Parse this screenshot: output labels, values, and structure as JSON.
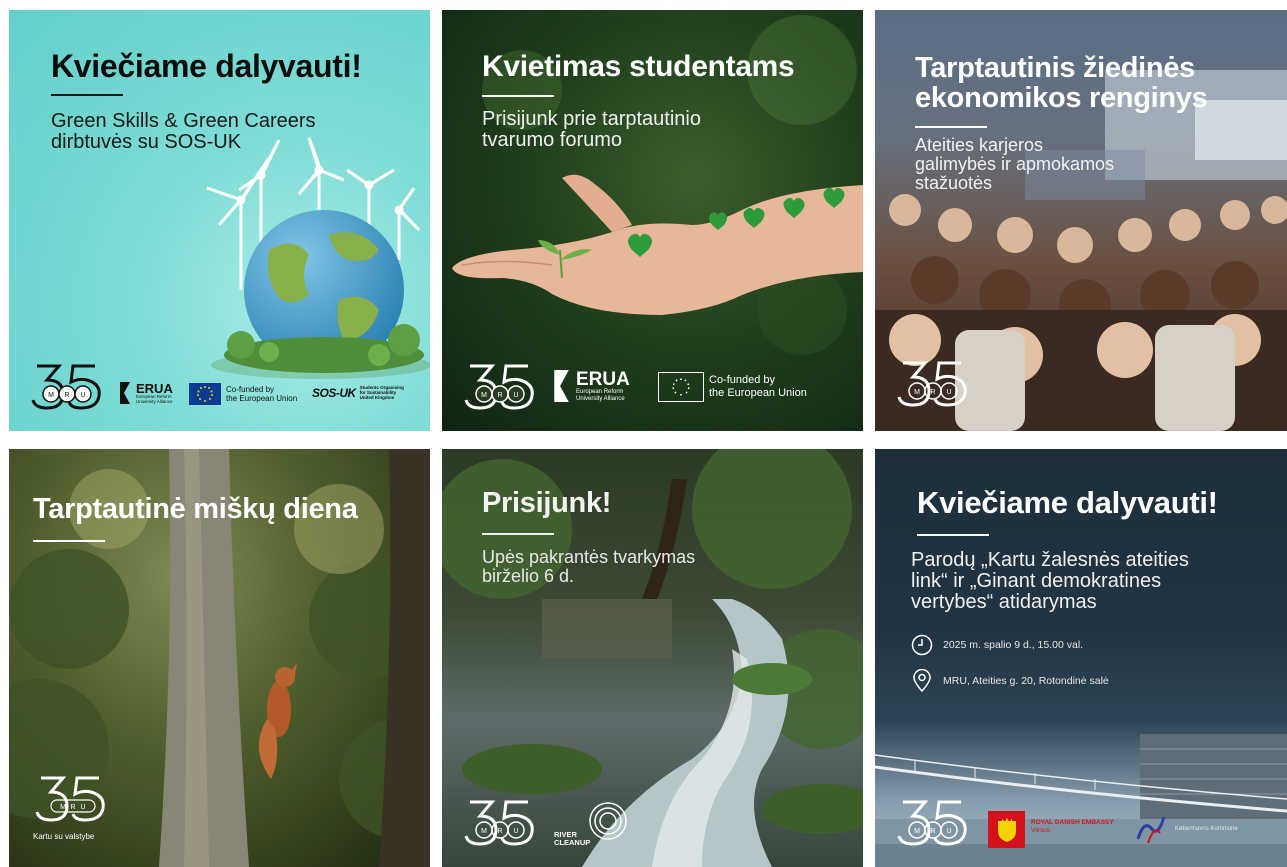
{
  "cards": [
    {
      "title": "Kviečiame dalyvauti!",
      "subtitle_lines": [
        "Green Skills & Green Careers",
        "dirbtuvės su SOS-UK"
      ],
      "logos": {
        "erua_name": "ERUA",
        "erua_sub": [
          "European Reform",
          "University Alliance"
        ],
        "eu_text": [
          "Co-funded by",
          "the European Union"
        ],
        "sos_name": "SOS-UK",
        "sos_sub": [
          "Students Organising",
          "for Sustainability",
          "United Kingdom"
        ]
      }
    },
    {
      "title": "Kvietimas studentams",
      "subtitle_lines": [
        "Prisijunk prie tarptautinio",
        "tvarumo forumo"
      ],
      "logos": {
        "erua_name": "ERUA",
        "erua_sub": [
          "European Reform",
          "University Alliance"
        ],
        "eu_text": [
          "Co-funded by",
          "the European Union"
        ]
      }
    },
    {
      "title_lines": [
        "Tarptautinis žiedinės",
        "ekonomikos renginys"
      ],
      "subtitle_lines": [
        "Ateities karjeros",
        "galimybės ir apmokamos",
        "stažuotės"
      ]
    },
    {
      "title": "Tarptautinė miškų diena",
      "logo_caption": "Kartu su valstybe"
    },
    {
      "title": "Prisijunk!",
      "subtitle_lines": [
        "Upės pakrantės tvarkymas",
        "birželio 6 d."
      ],
      "partner": [
        "RIVER",
        "CLEANUP"
      ]
    },
    {
      "title": "Kviečiame dalyvauti!",
      "subtitle_lines": [
        "Parodų „Kartu žalesnės ateities",
        "link“ ir „Ginant demokratines",
        "vertybes“ atidarymas"
      ],
      "date_text": "2025 m. spalio 9 d., 15.00 val.",
      "place_text": "MRU, Ateities g. 20, Rotondinė salė",
      "partner_embassy": "ROYAL DANISH EMBASSY",
      "partner_city": "Vilnius",
      "partner_right": "Københavns Kommune"
    }
  ],
  "mru_logo": {
    "number": "35",
    "letters": [
      "M",
      "R",
      "U"
    ]
  },
  "colors": {
    "card1_bg": "#7fdcd6",
    "card6_bg": "#1d2e3a",
    "heart_green": "#2f9a3a",
    "eu_blue": "#0a3d91",
    "eu_yellow": "#f5d300",
    "embassy_red": "#d3111c"
  }
}
